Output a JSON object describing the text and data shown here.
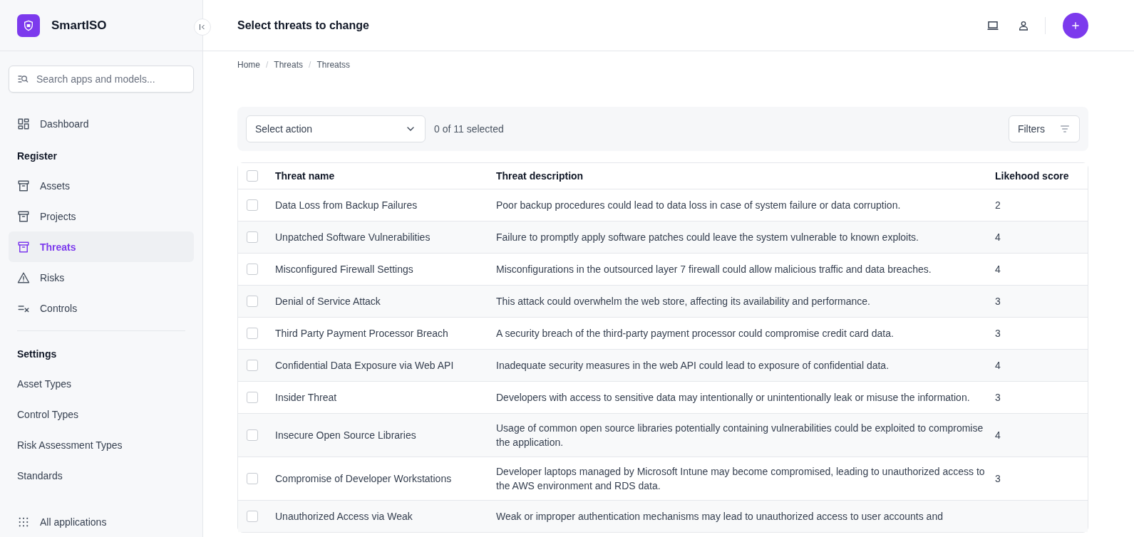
{
  "sidebar": {
    "brand": "SmartISO",
    "search": {
      "placeholder": "Search apps and models..."
    },
    "sections": [
      {
        "items": [
          {
            "label": "Dashboard",
            "selected": false
          }
        ]
      },
      {
        "heading": "Register",
        "items": [
          {
            "label": "Assets",
            "selected": false
          },
          {
            "label": "Projects",
            "selected": false
          },
          {
            "label": "Threats",
            "selected": true
          },
          {
            "label": "Risks",
            "selected": false
          },
          {
            "label": "Controls",
            "selected": false
          }
        ]
      },
      {
        "heading": "Settings",
        "items": [
          {
            "label": "Asset Types",
            "selected": false
          },
          {
            "label": "Control Types",
            "selected": false
          },
          {
            "label": "Risk Assessment Types",
            "selected": false
          },
          {
            "label": "Standards",
            "selected": false
          }
        ]
      }
    ],
    "footer": "All applications"
  },
  "header": {
    "title": "Select threats to change"
  },
  "breadcrumbs": [
    {
      "label": "Home"
    },
    {
      "separator": "/",
      "label": "Threats"
    },
    {
      "separator": "/",
      "label": "Threatss"
    }
  ],
  "toolbar": {
    "action": "Select action",
    "selection": "0 of 11 selected",
    "filters": "Filters"
  },
  "table": {
    "all_checked": false,
    "columns": [
      "Threat name",
      "Threat description",
      "Likehood score"
    ],
    "rows": [
      {
        "checked": false,
        "name": "Data Loss from Backup Failures",
        "description": "Poor backup procedures could lead to data loss in case of system failure or data corruption.",
        "score": "2"
      },
      {
        "checked": false,
        "name": "Unpatched Software Vulnerabilities",
        "description": "Failure to promptly apply software patches could leave the system vulnerable to known exploits.",
        "score": "4"
      },
      {
        "checked": false,
        "name": "Misconfigured Firewall Settings",
        "description": "Misconfigurations in the outsourced layer 7 firewall could allow malicious traffic and data breaches.",
        "score": "4"
      },
      {
        "checked": false,
        "name": "Denial of Service Attack",
        "description": "This attack could overwhelm the web store, affecting its availability and performance.",
        "score": "3"
      },
      {
        "checked": false,
        "name": "Third Party Payment Processor Breach",
        "description": "A security breach of the third-party payment processor could compromise credit card data.",
        "score": "3"
      },
      {
        "checked": false,
        "name": "Confidential Data Exposure via Web API",
        "description": "Inadequate security measures in the web API could lead to exposure of confidential data.",
        "score": "4"
      },
      {
        "checked": false,
        "name": "Insider Threat",
        "description": "Developers with access to sensitive data may intentionally or unintentionally leak or misuse the information.",
        "score": "3"
      },
      {
        "checked": false,
        "name": "Insecure Open Source Libraries",
        "description": "Usage of common open source libraries potentially containing vulnerabilities could be exploited to compromise the application.",
        "score": "4"
      },
      {
        "checked": false,
        "name": "Compromise of Developer Workstations",
        "description": "Developer laptops managed by Microsoft Intune may become compromised, leading to unauthorized access to the AWS environment and RDS data.",
        "score": "3"
      },
      {
        "checked": false,
        "name": "Unauthorized Access via Weak",
        "description": "Weak or improper authentication mechanisms may lead to unauthorized access to user accounts and"
      }
    ]
  }
}
